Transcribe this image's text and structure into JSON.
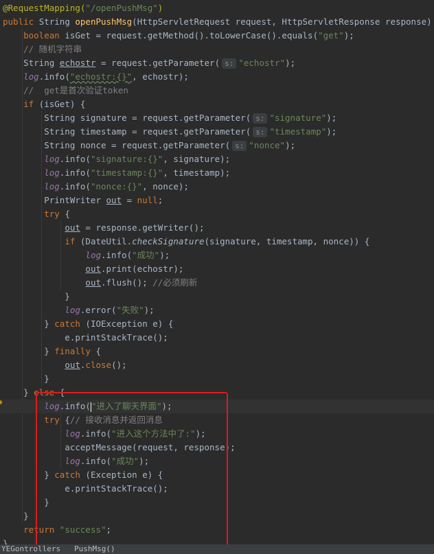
{
  "lines": [
    [
      {
        "t": "@RequestMapping(",
        "c": "ann"
      },
      {
        "t": "\"/openPushMsg\"",
        "c": "str"
      },
      {
        "t": ")",
        "c": "ann"
      }
    ],
    [
      {
        "t": "public ",
        "c": "kw"
      },
      {
        "t": "String "
      },
      {
        "t": "openPushMsg",
        "c": "fn"
      },
      {
        "t": "(HttpServletRequest request, HttpServletResponse response) {"
      }
    ],
    [
      {
        "t": "    "
      },
      {
        "t": "boolean ",
        "c": "kw"
      },
      {
        "t": "isGet = request.getMethod().toLowerCase().equals("
      },
      {
        "t": "\"get\"",
        "c": "str"
      },
      {
        "t": ");"
      }
    ],
    [
      {
        "t": "    // 随机字符串",
        "c": "cmt"
      }
    ],
    [
      {
        "t": "    String "
      },
      {
        "t": "echostr",
        "c": "ul"
      },
      {
        "t": " = request.getParameter("
      },
      {
        "hint": "s:"
      },
      {
        "t": "\"echostr\"",
        "c": "str"
      },
      {
        "t": ");"
      }
    ],
    [
      {
        "t": "    "
      },
      {
        "t": "log",
        "c": "log"
      },
      {
        "t": ".info("
      },
      {
        "t": "\"echostr:{}\"",
        "c": "str wavy"
      },
      {
        "t": ", echostr);"
      }
    ],
    [
      {
        "t": "    //  get是首次验证token",
        "c": "cmt"
      }
    ],
    [
      {
        "t": "    "
      },
      {
        "t": "if ",
        "c": "kw"
      },
      {
        "t": "(isGet) {"
      }
    ],
    [
      {
        "t": "        String signature = request.getParameter("
      },
      {
        "hint": "s:"
      },
      {
        "t": "\"signature\"",
        "c": "str"
      },
      {
        "t": ");"
      }
    ],
    [
      {
        "t": "        String timestamp = request.getParameter("
      },
      {
        "hint": "s:"
      },
      {
        "t": "\"timestamp\"",
        "c": "str"
      },
      {
        "t": ");"
      }
    ],
    [
      {
        "t": "        String nonce = request.getParameter("
      },
      {
        "hint": "s:"
      },
      {
        "t": "\"nonce\"",
        "c": "str"
      },
      {
        "t": ");"
      }
    ],
    [
      {
        "t": "        "
      },
      {
        "t": "log",
        "c": "log"
      },
      {
        "t": ".info("
      },
      {
        "t": "\"signature:{}\"",
        "c": "str"
      },
      {
        "t": ", signature);"
      }
    ],
    [
      {
        "t": "        "
      },
      {
        "t": "log",
        "c": "log"
      },
      {
        "t": ".info("
      },
      {
        "t": "\"timestamp:{}\"",
        "c": "str"
      },
      {
        "t": ", timestamp);"
      }
    ],
    [
      {
        "t": "        "
      },
      {
        "t": "log",
        "c": "log"
      },
      {
        "t": ".info("
      },
      {
        "t": "\"nonce:{}\"",
        "c": "str"
      },
      {
        "t": ", nonce);"
      }
    ],
    [
      {
        "t": "        PrintWriter "
      },
      {
        "t": "out",
        "c": "ul"
      },
      {
        "t": " = "
      },
      {
        "t": "null",
        "c": "kw"
      },
      {
        "t": ";"
      }
    ],
    [
      {
        "t": "        "
      },
      {
        "t": "try",
        "c": "kw"
      },
      {
        "t": " {"
      }
    ],
    [
      {
        "t": "            "
      },
      {
        "t": "out",
        "c": "ul"
      },
      {
        "t": " = response.getWriter();"
      }
    ],
    [
      {
        "t": "            "
      },
      {
        "t": "if ",
        "c": "kw"
      },
      {
        "t": "(DateUtil."
      },
      {
        "t": "checkSignature",
        "c": "static"
      },
      {
        "t": "(signature, timestamp, nonce)) {"
      }
    ],
    [
      {
        "t": "                "
      },
      {
        "t": "log",
        "c": "log"
      },
      {
        "t": ".info("
      },
      {
        "t": "\"成功\"",
        "c": "str"
      },
      {
        "t": ");"
      }
    ],
    [
      {
        "t": "                "
      },
      {
        "t": "out",
        "c": "ul"
      },
      {
        "t": ".print(echostr);"
      }
    ],
    [
      {
        "t": "                "
      },
      {
        "t": "out",
        "c": "ul"
      },
      {
        "t": ".flush(); "
      },
      {
        "t": "//必须刷新",
        "c": "cmt"
      }
    ],
    [
      {
        "t": "            }"
      }
    ],
    [
      {
        "t": "            "
      },
      {
        "t": "log",
        "c": "log"
      },
      {
        "t": ".error("
      },
      {
        "t": "\"失败\"",
        "c": "str"
      },
      {
        "t": ");"
      }
    ],
    [
      {
        "t": "        } "
      },
      {
        "t": "catch ",
        "c": "kw"
      },
      {
        "t": "(IOException e) {"
      }
    ],
    [
      {
        "t": "            e.printStackTrace();"
      }
    ],
    [
      {
        "t": "        } "
      },
      {
        "t": "finally ",
        "c": "kw"
      },
      {
        "t": "{"
      }
    ],
    [
      {
        "t": "            "
      },
      {
        "t": "out",
        "c": "ul"
      },
      {
        "t": "."
      },
      {
        "t": "close",
        "c": "kw"
      },
      {
        "t": "();"
      }
    ],
    [
      {
        "t": "        }"
      }
    ],
    [
      {
        "t": "    } "
      },
      {
        "t": "else ",
        "c": "kw"
      },
      {
        "t": "{"
      }
    ],
    [
      {
        "t": "        "
      },
      {
        "t": "log",
        "c": "log"
      },
      {
        "t": ".info("
      },
      {
        "caret": true
      },
      {
        "t": "\"进入了聊天界面\"",
        "c": "str"
      },
      {
        "t": ");"
      }
    ],
    [
      {
        "t": "        "
      },
      {
        "t": "try ",
        "c": "kw"
      },
      {
        "t": "{"
      },
      {
        "t": "// 接收消息并返回消息",
        "c": "cmt"
      }
    ],
    [
      {
        "t": "            "
      },
      {
        "t": "log",
        "c": "log"
      },
      {
        "t": ".info("
      },
      {
        "t": "\"进入这个方法中了:\"",
        "c": "str"
      },
      {
        "t": ");"
      }
    ],
    [
      {
        "t": "            acceptMessage(request, response);"
      }
    ],
    [
      {
        "t": "            "
      },
      {
        "t": "log",
        "c": "log"
      },
      {
        "t": ".info("
      },
      {
        "t": "\"成功\"",
        "c": "str"
      },
      {
        "t": ");"
      }
    ],
    [
      {
        "t": "        } "
      },
      {
        "t": "catch ",
        "c": "kw"
      },
      {
        "t": "(Exception e) {"
      }
    ],
    [
      {
        "t": "            e.printStackTrace();"
      }
    ],
    [
      {
        "t": "        }"
      }
    ],
    [
      {
        "t": "    }"
      }
    ],
    [
      {
        "t": "    "
      },
      {
        "t": "return ",
        "c": "kw"
      },
      {
        "t": "\"success\"",
        "c": "str"
      },
      {
        "t": ";"
      }
    ],
    [
      {
        "t": "}"
      }
    ]
  ],
  "highlighted_line_index": 29,
  "footer_text": "YEGontrollers   PushMsg()",
  "colors": {
    "background": "#2b2b2b",
    "keyword": "#cc7832",
    "string": "#6a8759",
    "annotation": "#bbb529",
    "comment": "#808080",
    "method_declaration": "#ffc66d",
    "log_field": "#9876aa",
    "annotation_box": "#e01a1a"
  }
}
